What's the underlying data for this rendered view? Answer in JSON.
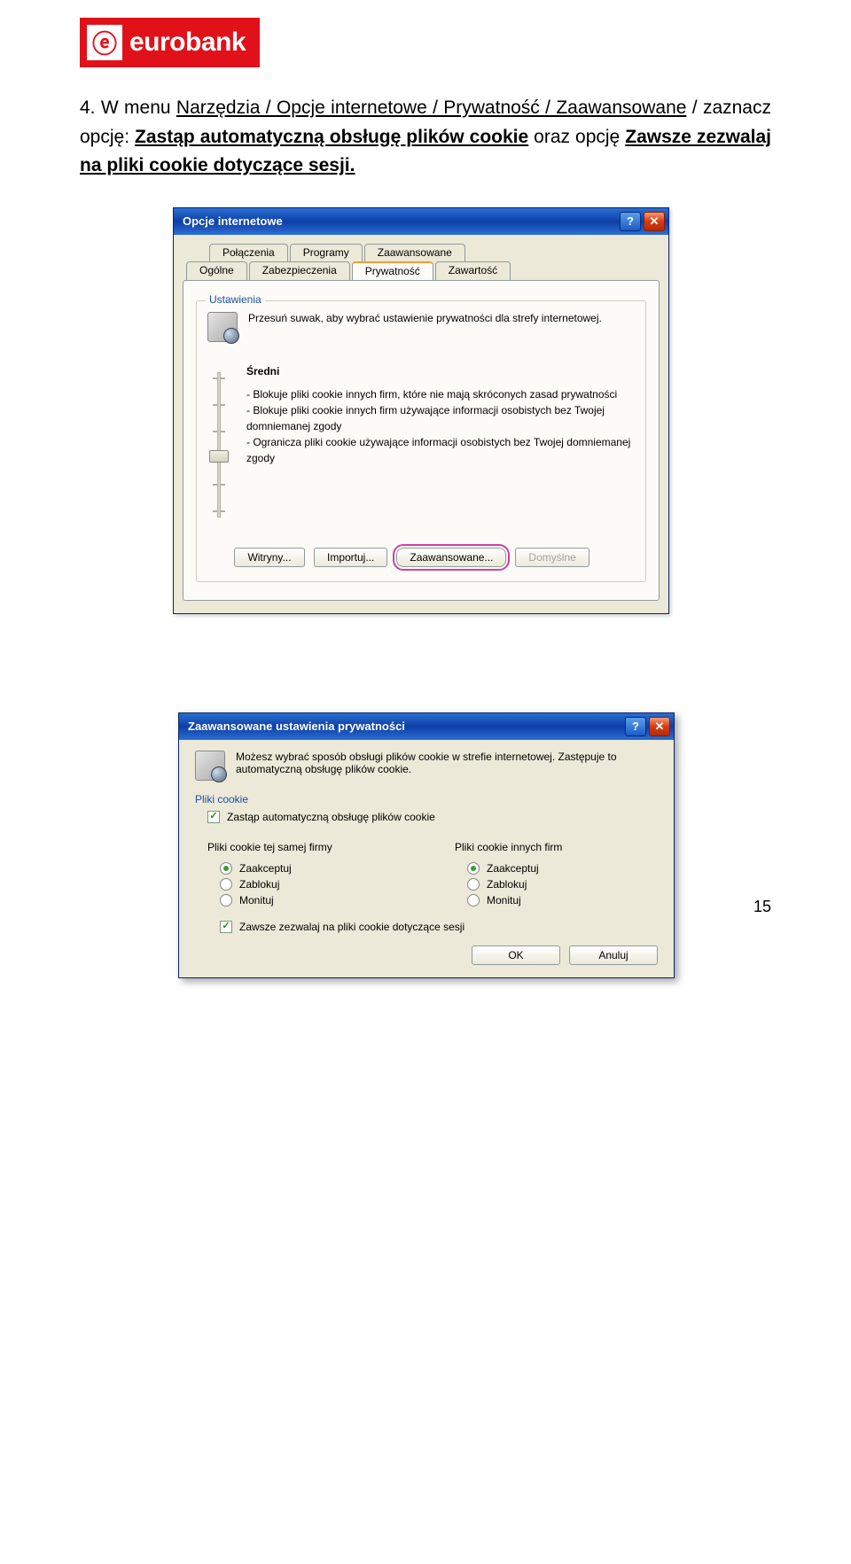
{
  "logo": {
    "glyph": "ⓔ",
    "brand": "eurobank"
  },
  "instruction": {
    "head": "4.   W menu ",
    "nav": "Narzędzia / Opcje internetowe / Prywatność / Zaawansowane",
    "mid": " / zaznacz opcję: ",
    "opt1": "Zastąp automatyczną obsługę plików cookie",
    "mid2": " oraz opcję ",
    "opt2": "Zawsze zezwalaj na pliki cookie dotyczące sesji.",
    "tail": ""
  },
  "dlg1": {
    "title": "Opcje internetowe",
    "help": "?",
    "close": "✕",
    "tabs_top": [
      "Połączenia",
      "Programy",
      "Zaawansowane"
    ],
    "tabs_bottom": [
      "Ogólne",
      "Zabezpieczenia",
      "Prywatność",
      "Zawartość"
    ],
    "group_label": "Ustawienia",
    "hint": "Przesuń suwak, aby wybrać ustawienie prywatności dla strefy internetowej.",
    "level": "Średni",
    "desc1": "- Blokuje pliki cookie innych firm, które nie mają skróconych zasad prywatności",
    "desc2": "- Blokuje pliki cookie innych firm używające informacji osobistych bez Twojej domniemanej zgody",
    "desc3": "- Ogranicza pliki cookie używające informacji osobistych bez Twojej domniemanej zgody",
    "btn_sites": "Witryny...",
    "btn_import": "Importuj...",
    "btn_adv": "Zaawansowane...",
    "btn_default": "Domyślne"
  },
  "dlg2": {
    "title": "Zaawansowane ustawienia prywatności",
    "intro": "Możesz wybrać sposób obsługi plików cookie w strefie internetowej. Zastępuje to automatyczną obsługę plików cookie.",
    "group_label": "Pliki cookie",
    "chk1": "Zastąp automatyczną obsługę plików cookie",
    "col1_head": "Pliki cookie tej samej firmy",
    "col2_head": "Pliki cookie innych firm",
    "opt_accept": "Zaakceptuj",
    "opt_block": "Zablokuj",
    "opt_prompt": "Monituj",
    "chk2": "Zawsze zezwalaj na pliki cookie dotyczące sesji",
    "btn_ok": "OK",
    "btn_cancel": "Anuluj"
  },
  "page_number": "15"
}
